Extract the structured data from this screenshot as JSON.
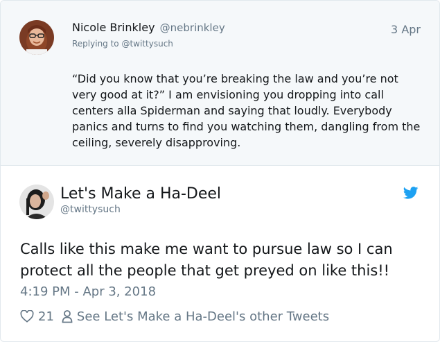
{
  "reply_tweet": {
    "author_name": "Nicole Brinkley",
    "author_handle": "@nebrinkley",
    "replying_to": "Replying to @twittysuch",
    "date": "3 Apr",
    "text": "“Did you know that you’re breaking the law and you’re not very good at it?” I am envisioning you dropping into call centers alla Spiderman and saying that loudly.  Everybody panics and turns to find you watching them, dangling from the ceiling, severely disapproving."
  },
  "main_tweet": {
    "author_name": "Let's Make a Ha-Deel",
    "author_handle": "@twittysuch",
    "text": "Calls like this make me want to pursue law so I can protect all the people that get preyed on like this!!",
    "timestamp": "4:19 PM - Apr 3, 2018",
    "like_count": "21",
    "other_tweets_link": "See Let's Make a Ha-Deel's other Tweets"
  },
  "icons": {
    "heart": "heart-icon",
    "person": "person-icon",
    "bird": "twitter-bird-icon"
  },
  "colors": {
    "twitter_blue": "#1da1f2",
    "secondary_text": "#657786",
    "primary_text": "#14171a",
    "reply_background": "#f5f8fa"
  }
}
